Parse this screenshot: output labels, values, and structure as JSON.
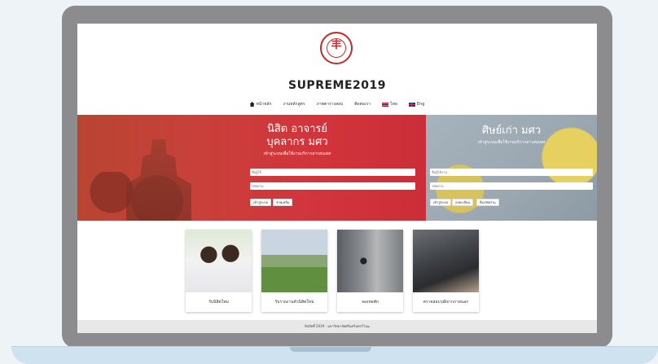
{
  "site": {
    "title": "SUPREME2019",
    "logo_glyph": "丰"
  },
  "nav": {
    "items": [
      {
        "label": "หน้าหลัก",
        "icon": "home-icon"
      },
      {
        "label": "งานหลักสูตร"
      },
      {
        "label": "ภาพตารางสอบ"
      },
      {
        "label": "ติดต่อเรา"
      },
      {
        "label": "ไทย",
        "icon": "thai-flag-icon"
      },
      {
        "label": "Eng",
        "icon": "uk-flag-icon"
      }
    ]
  },
  "hero_left": {
    "title_line1": "นิสิต อาจารย์",
    "title_line2": "บุคลากร มศว",
    "subtitle": "เข้าสู่ระบบเพื่อใช้งานบริการสารสนเทศ",
    "username_placeholder": "ชื่อผู้ใช้",
    "password_placeholder": "รหัสผ่าน",
    "login_label": "เข้าสู่ระบบ",
    "help_label": "ช่วยเหลือ"
  },
  "hero_right": {
    "title": "ศิษย์เก่า มศว",
    "subtitle": "เข้าสู่ระบบเพื่อใช้งานบริการสารสนเทศ",
    "username_placeholder": "ชื่อผู้ใช้งาน",
    "password_placeholder": "รหัสผ่าน",
    "login_label": "เข้าสู่ระบบ",
    "register_label": "ลงทะเบียน",
    "forgot_label": "ลืมรหัสผ่าน"
  },
  "cards": [
    {
      "label": "รับนิสิตใหม่"
    },
    {
      "label": "รับรายงานตัวนิสิตใหม่"
    },
    {
      "label": "จองหอพัก"
    },
    {
      "label": "ตรวจสอบวุฒิจากภายนอก"
    }
  ],
  "footer": {
    "text": "ลิขสิทธิ์ 2019 - มหาวิทยาลัยศรีนครินทรวิโรฒ"
  },
  "colors": {
    "brand_red": "#c32a2a",
    "frame": "#8c8c8e"
  }
}
